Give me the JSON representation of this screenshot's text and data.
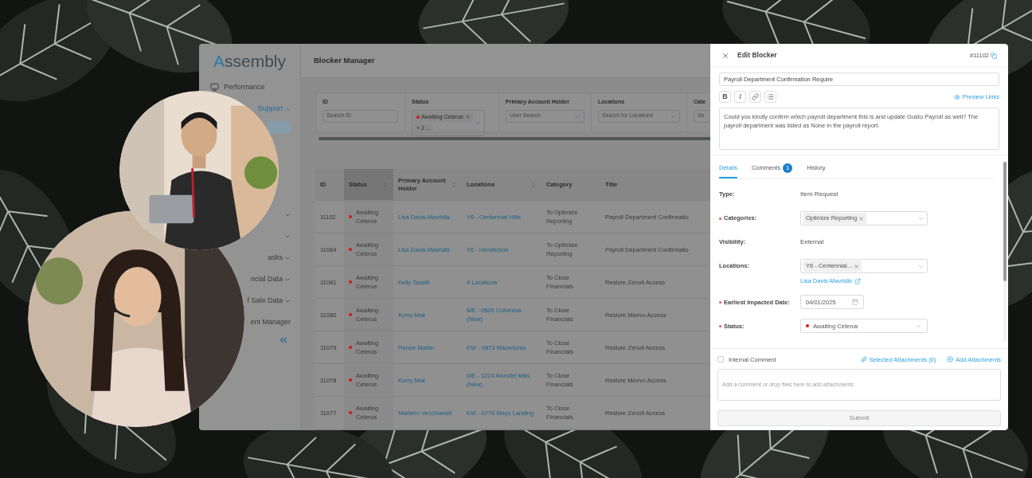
{
  "sidebar": {
    "logo": "Assembly",
    "items": [
      {
        "kind": "link",
        "label": "Performance",
        "selected": false
      },
      {
        "kind": "group",
        "label": "Support",
        "expanded": true,
        "selected": true
      },
      {
        "kind": "subitem",
        "selected": true
      },
      {
        "kind": "group",
        "expanded": false,
        "selected": false
      },
      {
        "kind": "group",
        "expanded": false,
        "selected": false
      },
      {
        "kind": "group",
        "label": "asks",
        "expanded": false,
        "selected": false
      },
      {
        "kind": "group",
        "label": "ncial Data",
        "expanded": false,
        "selected": false
      },
      {
        "kind": "group",
        "label": "f Sale Data",
        "expanded": false,
        "selected": false
      },
      {
        "kind": "link",
        "label": "ent Manager",
        "selected": false
      }
    ]
  },
  "main": {
    "title": "Blocker Manager",
    "filters": [
      {
        "kind": "input",
        "label": "ID",
        "placeholder": "Search ID"
      },
      {
        "kind": "tags",
        "label": "Status",
        "tags": [
          {
            "text": "Awaiting Ceterus",
            "color": "#d11a1a"
          }
        ],
        "more": "+ 2 ..."
      },
      {
        "kind": "select",
        "label": "Primary Account Holder",
        "placeholder": "User Search"
      },
      {
        "kind": "select",
        "label": "Locations",
        "placeholder": "Search for Locations"
      },
      {
        "kind": "input",
        "label": "Cate",
        "placeholder": "Se"
      }
    ],
    "table": {
      "columns": [
        {
          "label": "ID",
          "sortable": false,
          "sorted": false
        },
        {
          "label": "Status",
          "sortable": true,
          "sorted": true
        },
        {
          "label": "Primary Account Holder",
          "sortable": true,
          "sorted": false
        },
        {
          "label": "Locations",
          "sortable": true,
          "sorted": false
        },
        {
          "label": "Category",
          "sortable": false,
          "sorted": false
        },
        {
          "label": "Title",
          "sortable": false,
          "sorted": false
        }
      ],
      "rows": [
        {
          "id": "11102",
          "status": "Awaiting Ceterus",
          "color": "#d11a1a",
          "holder": "Lisa Davis-Mavridis",
          "location": "Y6 - Centennial Hills",
          "category": "To Optimize Reporting",
          "title": "Payroll Department Confirmatio"
        },
        {
          "id": "11084",
          "status": "Awaiting Ceterus",
          "color": "#d11a1a",
          "holder": "Lisa Davis-Mavridis",
          "location": "Y6 - Henderson",
          "category": "To Optimize Reporting",
          "title": "Payroll Department Confirmatio"
        },
        {
          "id": "11081",
          "status": "Awaiting Ceterus",
          "color": "#d11a1a",
          "holder": "Kelly Tavelli",
          "location": "4 Locations",
          "category": "To Close Financials",
          "title": "Restore Zenoti Access"
        },
        {
          "id": "11080",
          "status": "Awaiting Ceterus",
          "color": "#d11a1a",
          "holder": "Korry Mial",
          "location": "ME - 0505 Columbia (New)",
          "category": "To Close Financials",
          "title": "Restore Meevo Access"
        },
        {
          "id": "11079",
          "status": "Awaiting Ceterus",
          "color": "#d11a1a",
          "holder": "Renee Martin",
          "location": "EW - 0873 Macedonia",
          "category": "To Close Financials",
          "title": "Restore Zenoti Access"
        },
        {
          "id": "11078",
          "status": "Awaiting Ceterus",
          "color": "#d11a1a",
          "holder": "Korry Mial",
          "location": "ME - 1224 Arundel Mills (New)",
          "category": "To Close Financials",
          "title": "Restore Meevo Access"
        },
        {
          "id": "11077",
          "status": "Awaiting Ceterus",
          "color": "#d11a1a",
          "holder": "Marleen Vecchiarelli",
          "location": "EW - 0776 Mays Landing",
          "category": "To Close Financials",
          "title": "Restore Zenoti Access"
        }
      ]
    }
  },
  "drawer": {
    "title": "Edit Blocker",
    "ticket": "#11102",
    "name_value": "Payroll Department Confirmation Require",
    "toolbar": [
      {
        "kind": "bold",
        "label": "B"
      },
      {
        "kind": "italic",
        "label": "I"
      },
      {
        "kind": "link"
      },
      {
        "kind": "list"
      }
    ],
    "preview_link": "Preview Links",
    "description": "Could you kindly confirm which payroll department this is and update Gusto Payroll as well? The payroll department was listed as None in the payroll report.",
    "tabs": [
      {
        "label": "Details",
        "selected": true
      },
      {
        "label": "Comments",
        "selected": false,
        "badge": "1"
      },
      {
        "label": "History",
        "selected": false
      }
    ],
    "fields": [
      {
        "kind": "text",
        "label": "Type:",
        "required": false,
        "value": "Item Request"
      },
      {
        "kind": "tags",
        "label": "Categories:",
        "required": true,
        "tags": [
          "Optimize Reporting"
        ]
      },
      {
        "kind": "text",
        "label": "Visibility:",
        "required": false,
        "value": "External"
      },
      {
        "kind": "tags",
        "label": "Locations:",
        "required": false,
        "tags": [
          "Y6 - Centennial..."
        ],
        "link": "Lisa Davis-Mavridis"
      },
      {
        "kind": "date",
        "label": "Earliest Impacted Date:",
        "required": true,
        "value": "04/01/2025"
      },
      {
        "kind": "status",
        "label": "Status:",
        "required": true,
        "value": "Awaiting Ceterus",
        "color": "#d11a1a"
      }
    ],
    "composer": {
      "internal_comment": {
        "label": "Internal Comment",
        "checked": false
      },
      "selected_attachments": "Selected Attachments (0)",
      "add_attachments": "Add Attachments",
      "placeholder": "Add a comment or drop files here to add attachments",
      "submit": {
        "label": "Submit",
        "disabled": true
      }
    }
  }
}
